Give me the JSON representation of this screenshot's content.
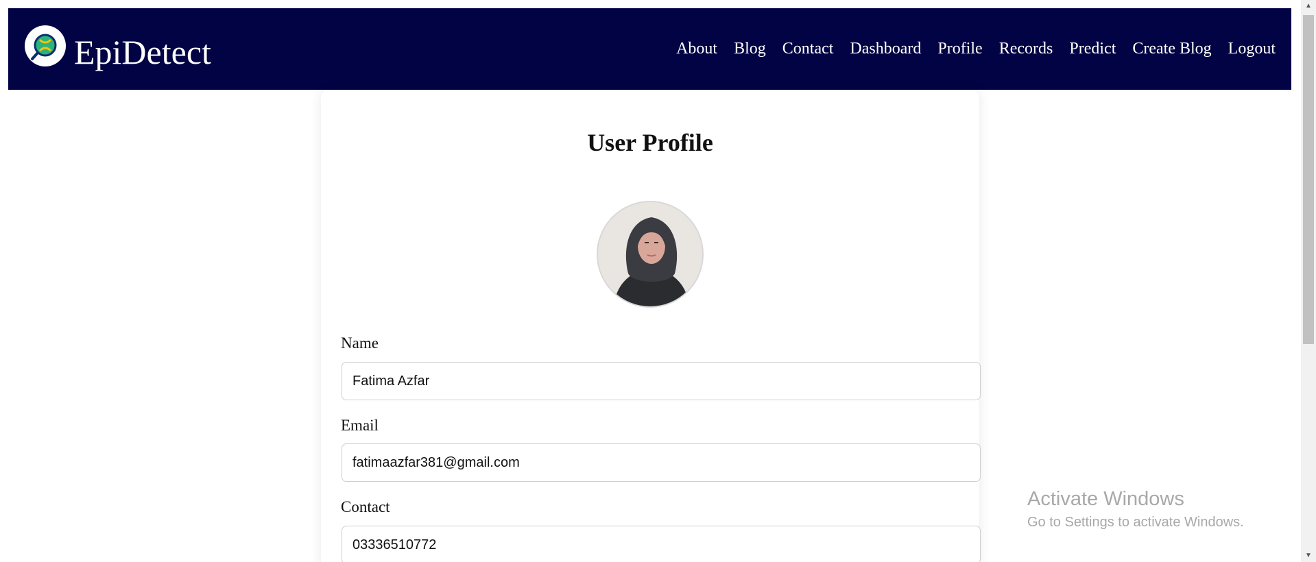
{
  "brand": {
    "name": "EpiDetect"
  },
  "nav": [
    "About",
    "Blog",
    "Contact",
    "Dashboard",
    "Profile",
    "Records",
    "Predict",
    "Create Blog",
    "Logout"
  ],
  "profile": {
    "title": "User Profile",
    "fields": [
      {
        "label": "Name",
        "value": "Fatima Azfar"
      },
      {
        "label": "Email",
        "value": "fatimaazfar381@gmail.com"
      },
      {
        "label": "Contact",
        "value": "03336510772"
      }
    ]
  },
  "watermark": {
    "title": "Activate Windows",
    "subtitle": "Go to Settings to activate Windows."
  },
  "colors": {
    "navbar": "#020344",
    "text": "#111111"
  }
}
